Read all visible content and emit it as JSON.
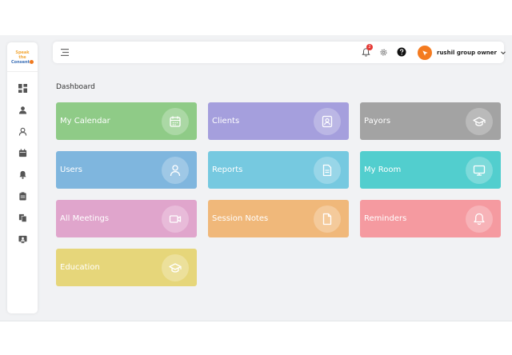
{
  "logo": {
    "line1": "Speak the",
    "line2": "Consent"
  },
  "sidebar": {
    "items": [
      {
        "name": "sidebar-item-dashboard",
        "icon": "dashboard-icon"
      },
      {
        "name": "sidebar-item-clients",
        "icon": "client-card-icon"
      },
      {
        "name": "sidebar-item-users",
        "icon": "user-icon"
      },
      {
        "name": "sidebar-item-calendar",
        "icon": "calendar-icon"
      },
      {
        "name": "sidebar-item-reminders",
        "icon": "bell-icon"
      },
      {
        "name": "sidebar-item-notes",
        "icon": "clipboard-icon"
      },
      {
        "name": "sidebar-item-reports",
        "icon": "documents-icon"
      },
      {
        "name": "sidebar-item-room",
        "icon": "monitor-user-icon"
      }
    ]
  },
  "header": {
    "notification_count": "2",
    "user_name": "rushil group owner"
  },
  "main": {
    "title": "Dashboard",
    "tiles": [
      {
        "label": "My Calendar",
        "color": "#8fcb87",
        "icon": "calendar-icon"
      },
      {
        "label": "Clients",
        "color": "#a59fdd",
        "icon": "client-card-icon"
      },
      {
        "label": "Payors",
        "color": "#a3a3a3",
        "icon": "graduation-cap-icon"
      },
      {
        "label": "Users",
        "color": "#7fb6de",
        "icon": "user-icon"
      },
      {
        "label": "Reports",
        "color": "#76c9e0",
        "icon": "document-icon"
      },
      {
        "label": "My Room",
        "color": "#52cece",
        "icon": "monitor-icon"
      },
      {
        "label": "All Meetings",
        "color": "#e0a5cc",
        "icon": "video-icon"
      },
      {
        "label": "Session Notes",
        "color": "#f0b87a",
        "icon": "file-icon"
      },
      {
        "label": "Reminders",
        "color": "#f59aa0",
        "icon": "bell-icon"
      },
      {
        "label": "Education",
        "color": "#e6d67a",
        "icon": "graduation-cap-icon"
      }
    ]
  }
}
